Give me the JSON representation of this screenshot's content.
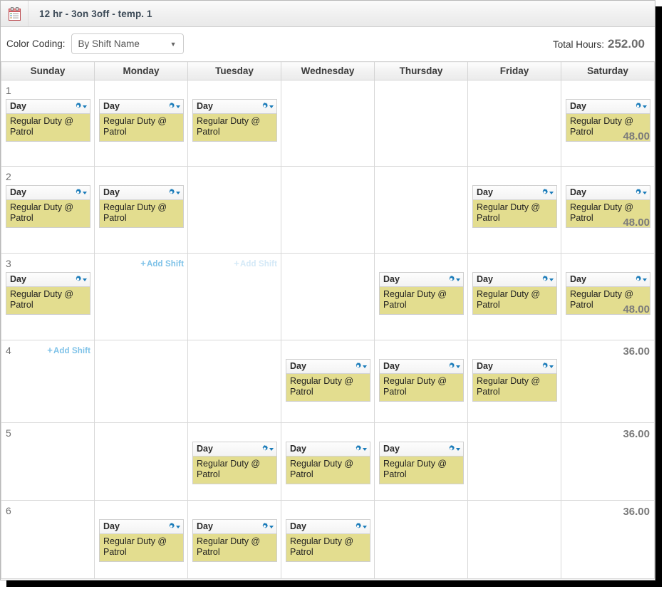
{
  "window": {
    "title": "12 hr - 3on 3off - temp. 1",
    "icon": "clipboard-icon"
  },
  "toolbar": {
    "color_coding_label": "Color Coding:",
    "color_coding_value": "By Shift Name",
    "color_coding_options": [
      "By Shift Name"
    ],
    "total_hours_label": "Total Hours:",
    "total_hours_value": "252.00"
  },
  "grid": {
    "day_headers": [
      "Sunday",
      "Monday",
      "Tuesday",
      "Wednesday",
      "Thursday",
      "Friday",
      "Saturday"
    ],
    "add_shift_label": "Add Shift",
    "add_shift_plus": "+",
    "shift_name": "Day",
    "shift_detail": "Regular Duty @ Patrol",
    "shift_color": "#e3dd8f",
    "gear_color": "#1a7bb9",
    "rows": [
      {
        "week": "1",
        "hours": "48.00",
        "add_shift": null,
        "days": [
          true,
          true,
          true,
          false,
          false,
          false,
          true
        ]
      },
      {
        "week": "2",
        "hours": "48.00",
        "add_shift": null,
        "days": [
          true,
          true,
          false,
          false,
          false,
          true,
          true
        ]
      },
      {
        "week": "3",
        "hours": "48.00",
        "add_shift": "monday-tuesday",
        "days": [
          true,
          false,
          false,
          false,
          true,
          true,
          true
        ]
      },
      {
        "week": "4",
        "hours": "36.00",
        "add_shift": "sunday",
        "days": [
          false,
          false,
          false,
          true,
          true,
          true,
          false
        ]
      },
      {
        "week": "5",
        "hours": "36.00",
        "add_shift": null,
        "days": [
          false,
          false,
          true,
          true,
          true,
          false,
          false
        ]
      },
      {
        "week": "6",
        "hours": "36.00",
        "add_shift": null,
        "days": [
          false,
          true,
          true,
          true,
          false,
          false,
          false
        ]
      }
    ]
  }
}
